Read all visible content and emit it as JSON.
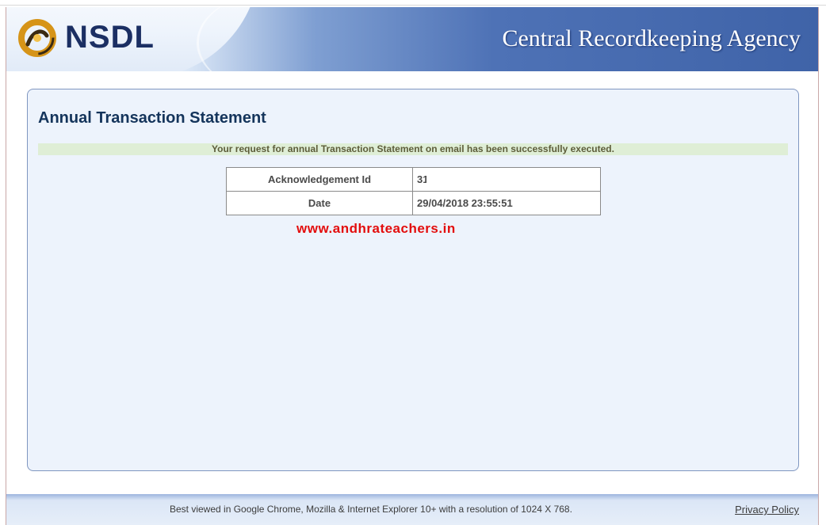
{
  "header": {
    "brand": "NSDL",
    "agency": "Central Recordkeeping Agency"
  },
  "panel": {
    "title": "Annual Transaction Statement",
    "message": "Your request for annual Transaction Statement on email has been successfully executed.",
    "rows": [
      {
        "label": "Acknowledgement Id",
        "value": "31"
      },
      {
        "label": "Date",
        "value": "29/04/2018 23:55:51"
      }
    ],
    "watermark": "www.andhrateachers.in"
  },
  "footer": {
    "note": "Best viewed in Google Chrome, Mozilla & Internet Explorer 10+ with a resolution of 1024 X 768.",
    "privacy": "Privacy Policy"
  },
  "colors": {
    "brand_text": "#1b2f63",
    "title": "#14345b",
    "success_bg": "#dfeed6",
    "watermark": "#e30d0d"
  },
  "icons": {
    "logo": "nsdl-logo-icon"
  }
}
